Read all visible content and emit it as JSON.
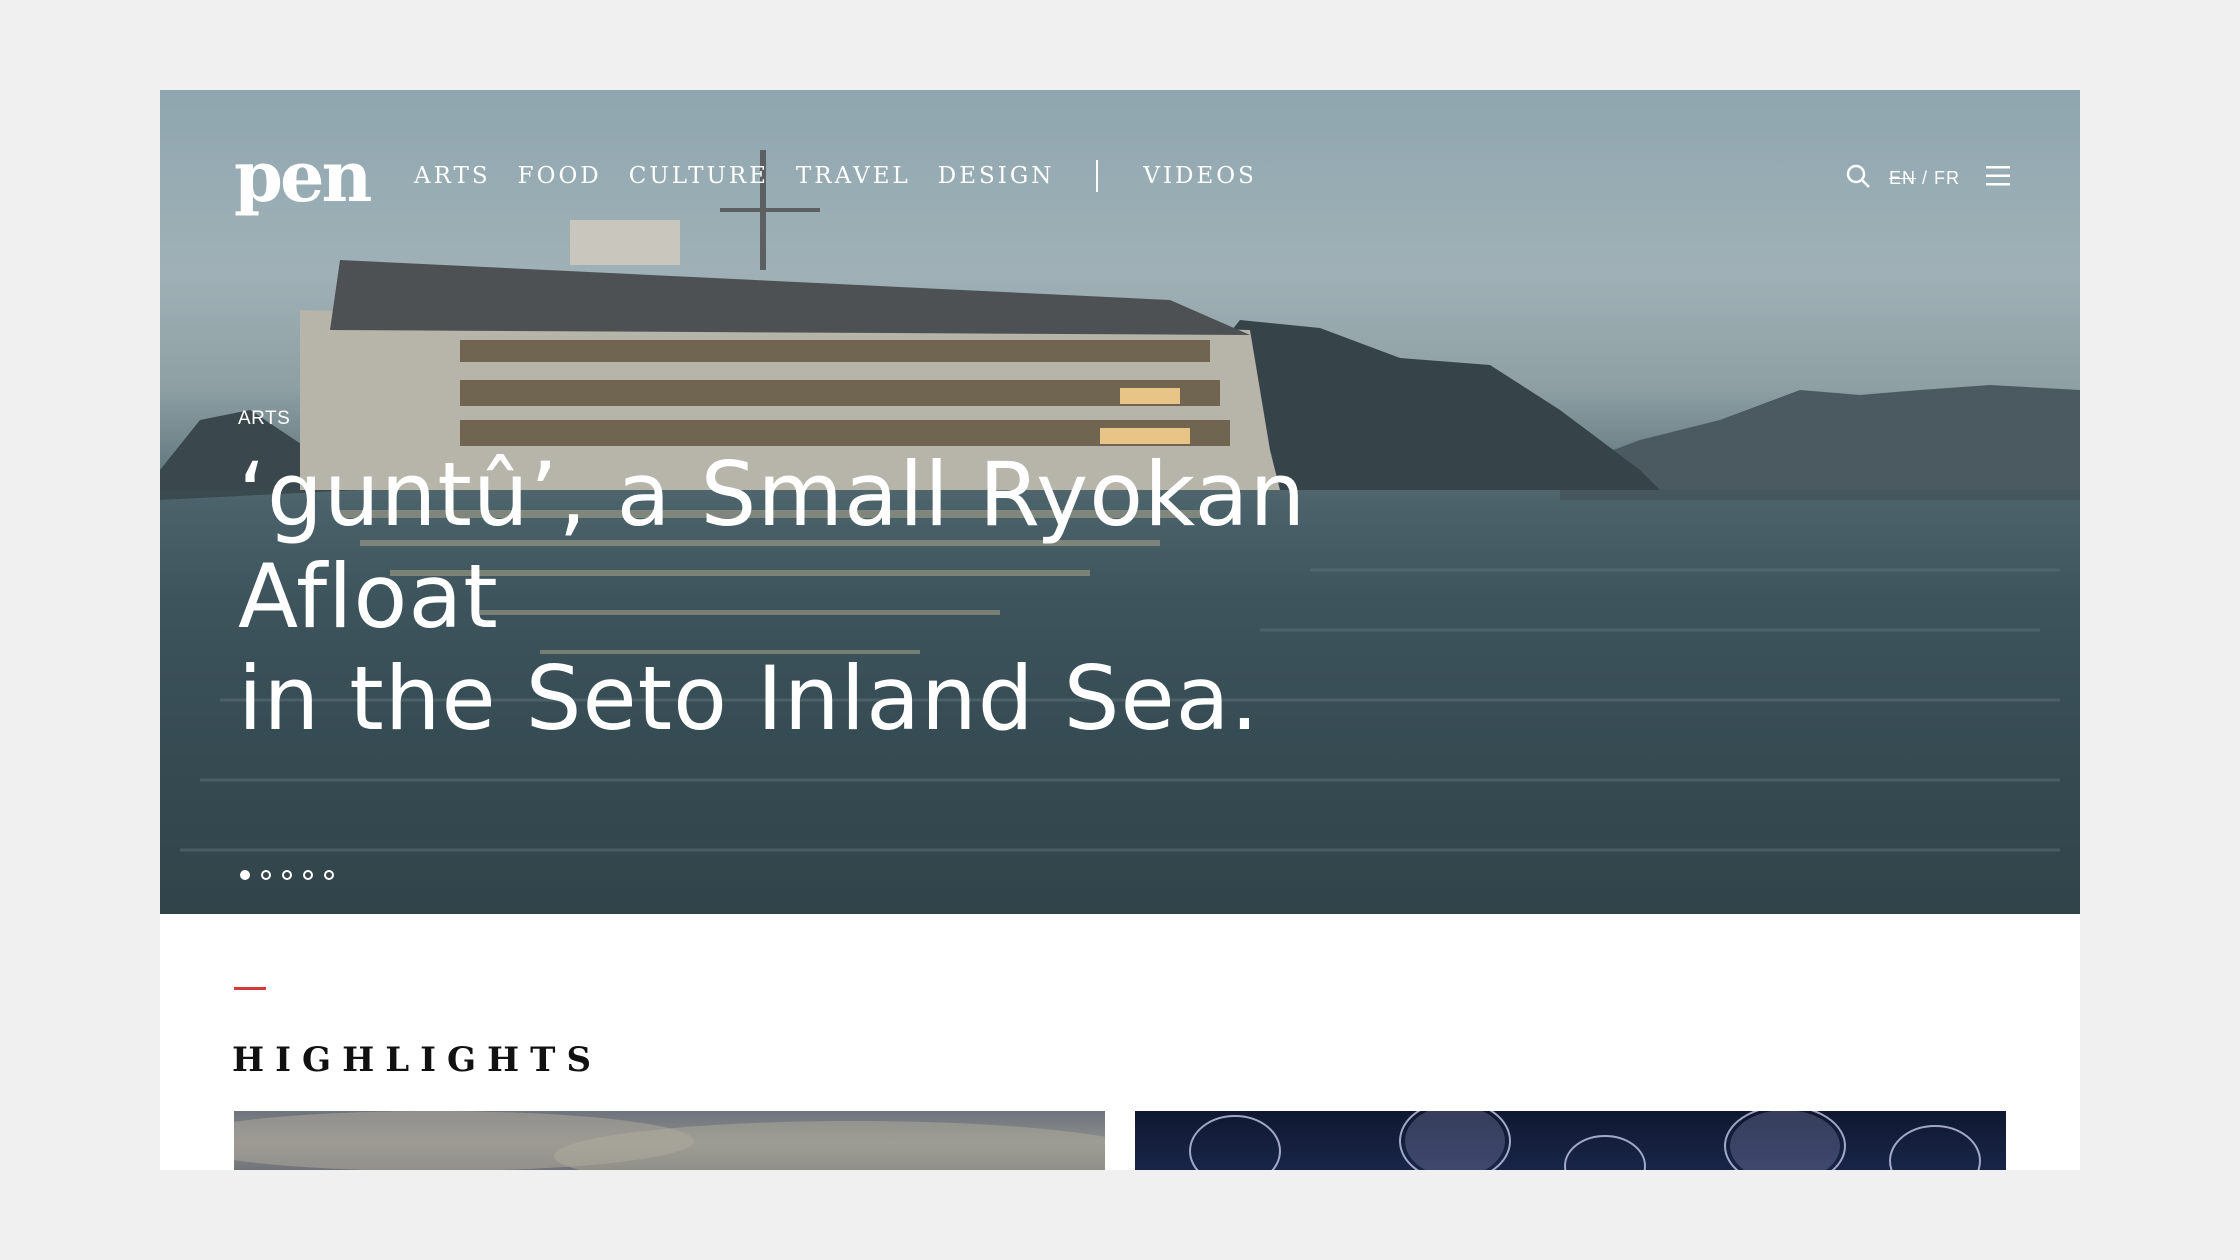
{
  "nav": {
    "logo": "pen",
    "links": [
      "ARTS",
      "FOOD",
      "CULTURE",
      "TRAVEL",
      "DESIGN"
    ],
    "videos": "VIDEOS",
    "lang_en": "EN",
    "lang_sep": "/",
    "lang_fr": "FR"
  },
  "hero": {
    "category": "ARTS",
    "headline_line1": "‘guntû’, a Small Ryokan Afloat",
    "headline_line2": "in the Seto Inland Sea.",
    "slides": 5,
    "active_slide": 1
  },
  "highlights": {
    "title": "HIGHLIGHTS"
  },
  "colors": {
    "accent": "#d33a3a",
    "page_bg": "#f0f0f0"
  },
  "icons": [
    "search-icon",
    "hamburger-menu-icon"
  ]
}
